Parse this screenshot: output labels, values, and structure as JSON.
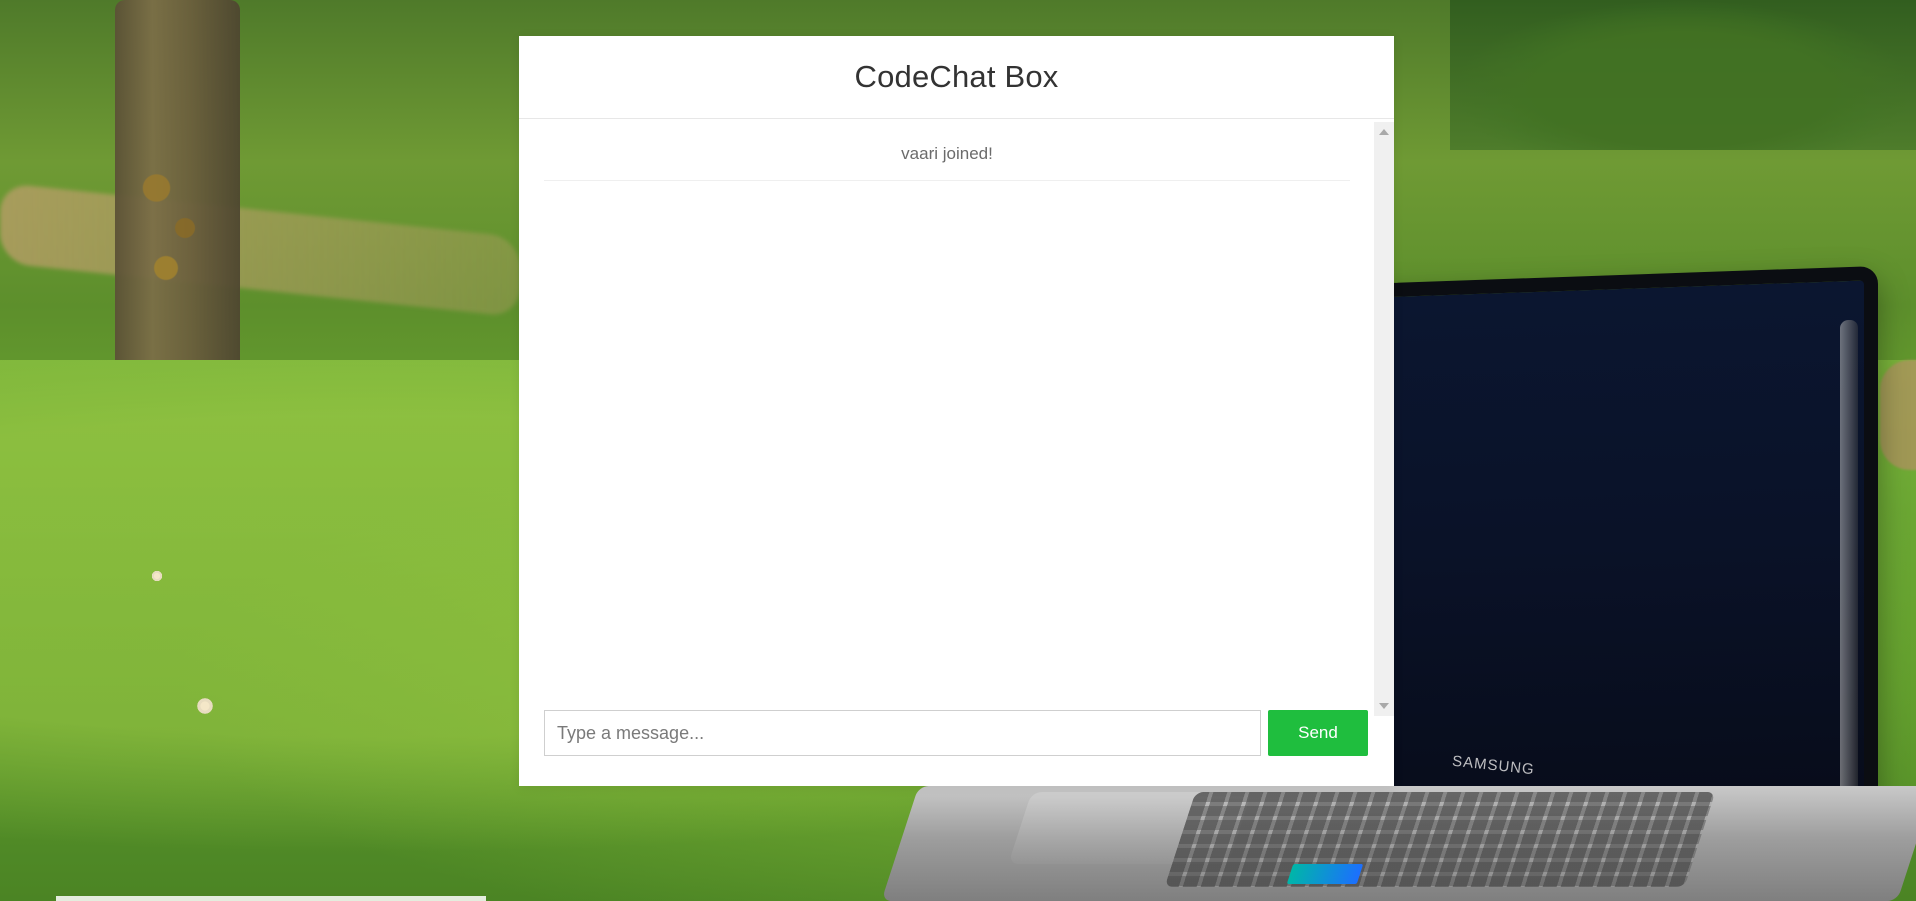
{
  "page": {
    "background_theme": "grass-and-laptop-photo",
    "accent_color": "#1fbe3e"
  },
  "chat": {
    "title": "CodeChat Box",
    "messages": [
      {
        "type": "system",
        "text": "vaari joined!"
      }
    ],
    "input": {
      "placeholder": "Type a message...",
      "value": ""
    },
    "send_label": "Send"
  },
  "background": {
    "laptop_brand": "SAMSUNG"
  }
}
